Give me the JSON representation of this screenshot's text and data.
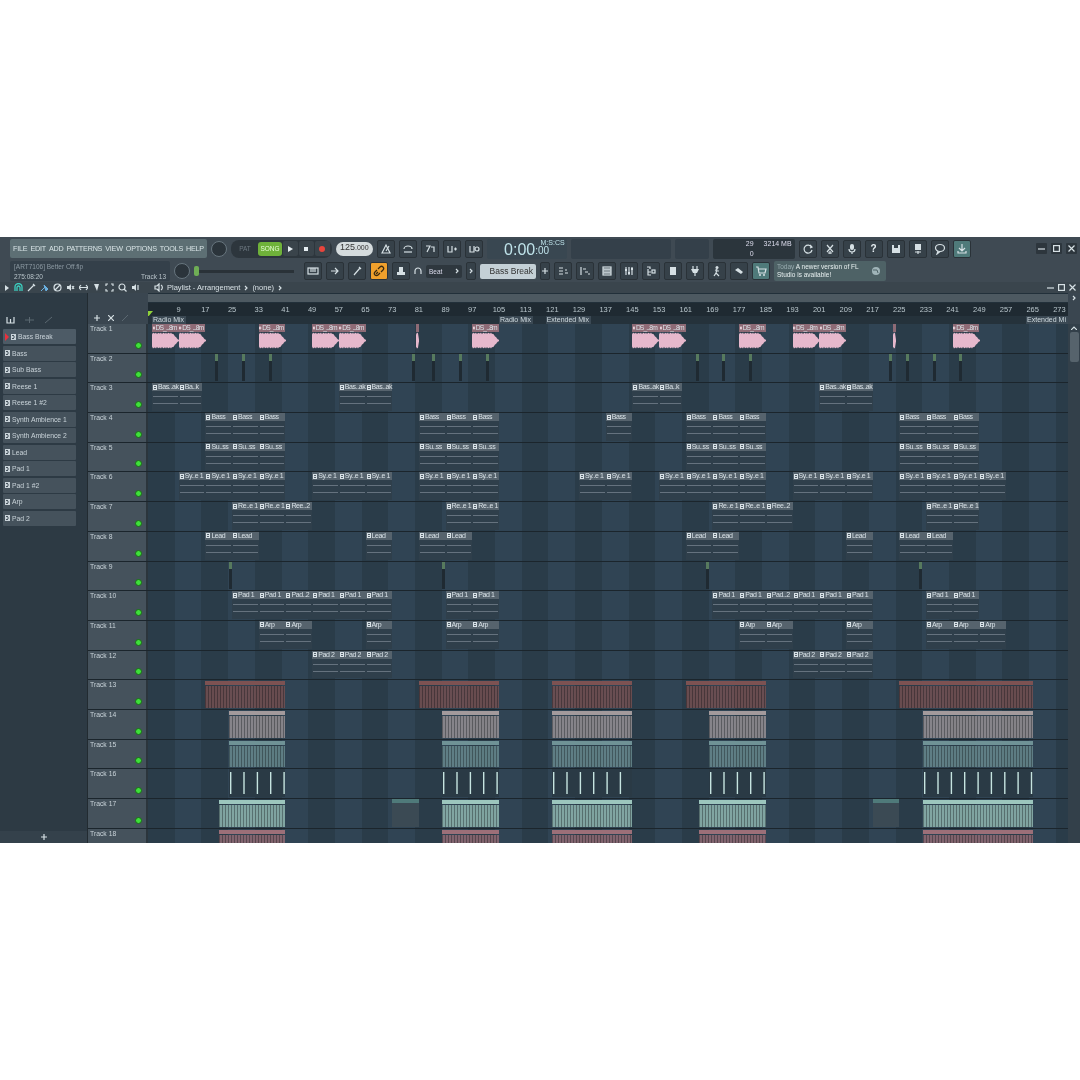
{
  "menu": [
    "FILE",
    "EDIT",
    "ADD",
    "PATTERNS",
    "VIEW",
    "OPTIONS",
    "TOOLS",
    "HELP"
  ],
  "hint": {
    "file": "[ART7106] Better Off.flp",
    "position": "275:08:20",
    "target": "Track 13"
  },
  "mode": [
    {
      "label": "PAT",
      "selected": false
    },
    {
      "label": "SONG",
      "selected": true
    }
  ],
  "tempo": {
    "main": "125",
    "fraction": ".000"
  },
  "time": {
    "main": "0:00",
    "sub": ":00",
    "unit": "M:S:CS"
  },
  "cpu": {
    "cpu": "29",
    "memory": "3214 MB",
    "polyphony": "0"
  },
  "help_glyph": "?",
  "pitch": {
    "level": 0
  },
  "snap_link": {
    "on": true
  },
  "snap": "Beat",
  "pattern": "Bass Break",
  "news": {
    "when": "Today",
    "text": "A newer version of FL Studio is available!"
  },
  "playlist": {
    "title": "Playlist - Arrangement",
    "target": "(none)"
  },
  "channels": [
    {
      "name": "Bass Break",
      "selected": true
    },
    {
      "name": "Bass",
      "selected": false
    },
    {
      "name": "Sub Bass",
      "selected": false
    },
    {
      "name": "Reese 1",
      "selected": false
    },
    {
      "name": "Reese 1 #2",
      "selected": false
    },
    {
      "name": "Synth Ambience 1",
      "selected": false
    },
    {
      "name": "Synth Ambience 2",
      "selected": false
    },
    {
      "name": "Lead",
      "selected": false
    },
    {
      "name": "Pad 1",
      "selected": false
    },
    {
      "name": "Pad 1 #2",
      "selected": false
    },
    {
      "name": "Arp",
      "selected": false
    },
    {
      "name": "Pad 2",
      "selected": false
    }
  ],
  "ruler": [
    "9",
    "17",
    "25",
    "33",
    "41",
    "49",
    "57",
    "65",
    "73",
    "81",
    "89",
    "97",
    "105",
    "113",
    "121",
    "129",
    "137",
    "145",
    "153",
    "161",
    "169",
    "177",
    "185",
    "193",
    "201",
    "209",
    "217",
    "225",
    "233",
    "241",
    "249",
    "257",
    "265",
    "273"
  ],
  "markers": [
    {
      "label": "Radio Mix"
    },
    {
      "label": "Radio Mix"
    },
    {
      "label": "Extended Mix"
    },
    {
      "label": "Extended Mi"
    }
  ],
  "tracks": [
    {
      "name": "Track 1",
      "enabled": true,
      "clips": [
        {
          "kind": "audio",
          "label": "DS_...8m"
        },
        {
          "kind": "audio",
          "label": "DS_...8m"
        },
        {
          "kind": "audio",
          "label": "DS_...8m"
        },
        {
          "kind": "audio",
          "label": "DS_...8m"
        },
        {
          "kind": "audio",
          "label": "DS_...8m"
        },
        {
          "kind": "audio"
        },
        {
          "kind": "audio",
          "label": "DS_...8m"
        },
        {
          "kind": "audio",
          "label": "DS_...8m"
        },
        {
          "kind": "audio",
          "label": "DS_...8m"
        },
        {
          "kind": "audio",
          "label": "DS_...8m"
        },
        {
          "kind": "audio",
          "label": "DS_...8m"
        },
        {
          "kind": "audio",
          "label": "DS_...8m"
        },
        {
          "kind": "audio"
        },
        {
          "kind": "audio",
          "label": "DS_...8m"
        }
      ]
    },
    {
      "name": "Track 2",
      "enabled": true,
      "clips": [
        {
          "kind": "tick"
        },
        {
          "kind": "tick"
        },
        {
          "kind": "tick"
        },
        {
          "kind": "tick"
        },
        {
          "kind": "tick"
        },
        {
          "kind": "tick"
        },
        {
          "kind": "tick"
        },
        {
          "kind": "tick"
        },
        {
          "kind": "tick"
        },
        {
          "kind": "tick"
        },
        {
          "kind": "tick"
        },
        {
          "kind": "tick"
        },
        {
          "kind": "tick"
        },
        {
          "kind": "tick"
        }
      ]
    },
    {
      "name": "Track 3",
      "enabled": true,
      "clips": [
        {
          "kind": "pattern",
          "label": "Bas..ak"
        },
        {
          "kind": "pattern",
          "label": "Ba..k"
        },
        {
          "kind": "pattern",
          "label": "Bas..ak"
        },
        {
          "kind": "pattern",
          "label": "Bas..ak"
        },
        {
          "kind": "pattern",
          "label": "Bas..ak"
        },
        {
          "kind": "pattern",
          "label": "Ba..k"
        },
        {
          "kind": "pattern",
          "label": "Bas..ak"
        },
        {
          "kind": "pattern",
          "label": "Bas..ak"
        }
      ]
    },
    {
      "name": "Track 4",
      "enabled": true,
      "clips": [
        {
          "kind": "pattern",
          "label": "Bass"
        },
        {
          "kind": "pattern",
          "label": "Bass"
        },
        {
          "kind": "pattern",
          "label": "Bass"
        },
        {
          "kind": "pattern",
          "label": "Bass"
        },
        {
          "kind": "pattern",
          "label": "Bass"
        },
        {
          "kind": "pattern",
          "label": "Bass"
        },
        {
          "kind": "pattern",
          "label": "Bass"
        },
        {
          "kind": "pattern",
          "label": "Bass"
        },
        {
          "kind": "pattern",
          "label": "Bass"
        },
        {
          "kind": "pattern",
          "label": "Bass"
        },
        {
          "kind": "pattern",
          "label": "Bass"
        },
        {
          "kind": "pattern",
          "label": "Bass"
        },
        {
          "kind": "pattern",
          "label": "Bass"
        }
      ]
    },
    {
      "name": "Track 5",
      "enabled": true,
      "clips": [
        {
          "kind": "pattern",
          "label": "Su..ss"
        },
        {
          "kind": "pattern",
          "label": "Su..ss"
        },
        {
          "kind": "pattern",
          "label": "Su..ss"
        },
        {
          "kind": "pattern",
          "label": "Su..ss"
        },
        {
          "kind": "pattern",
          "label": "Su..ss"
        },
        {
          "kind": "pattern",
          "label": "Su..ss"
        },
        {
          "kind": "pattern",
          "label": "Su..ss"
        },
        {
          "kind": "pattern",
          "label": "Su..ss"
        },
        {
          "kind": "pattern",
          "label": "Su..ss"
        },
        {
          "kind": "pattern",
          "label": "Su..ss"
        },
        {
          "kind": "pattern",
          "label": "Su..ss"
        },
        {
          "kind": "pattern",
          "label": "Su..ss"
        }
      ]
    },
    {
      "name": "Track 6",
      "enabled": true,
      "clips": [
        {
          "kind": "pattern",
          "label": "Sy..e 1"
        },
        {
          "kind": "pattern",
          "label": "Sy..e 1"
        },
        {
          "kind": "pattern",
          "label": "Sy..e 1"
        },
        {
          "kind": "pattern",
          "label": "Sy..e 1"
        },
        {
          "kind": "pattern",
          "label": "Sy..e 1"
        },
        {
          "kind": "pattern",
          "label": "Sy..e 1"
        },
        {
          "kind": "pattern",
          "label": "Sy..e 1"
        },
        {
          "kind": "pattern",
          "label": "Sy..e 1"
        },
        {
          "kind": "pattern",
          "label": "Sy..e 1"
        },
        {
          "kind": "pattern",
          "label": "Sy..e 1"
        },
        {
          "kind": "pattern",
          "label": "Sy..e 1"
        },
        {
          "kind": "pattern",
          "label": "Sy..e 1"
        },
        {
          "kind": "pattern",
          "label": "Sy..e 1"
        },
        {
          "kind": "pattern",
          "label": "Sy..e 1"
        },
        {
          "kind": "pattern",
          "label": "Sy..e 1"
        },
        {
          "kind": "pattern",
          "label": "Sy..e 1"
        },
        {
          "kind": "pattern",
          "label": "Sy..e 1"
        },
        {
          "kind": "pattern",
          "label": "Sy..e 1"
        },
        {
          "kind": "pattern",
          "label": "Sy..e 1"
        },
        {
          "kind": "pattern",
          "label": "Sy..e 1"
        },
        {
          "kind": "pattern",
          "label": "Sy..e 1"
        },
        {
          "kind": "pattern",
          "label": "Sy..e 1"
        },
        {
          "kind": "pattern",
          "label": "Sy..e 1"
        }
      ]
    },
    {
      "name": "Track 7",
      "enabled": true,
      "clips": [
        {
          "kind": "pattern",
          "label": "Re..e 1"
        },
        {
          "kind": "pattern",
          "label": "Re..e 1"
        },
        {
          "kind": "pattern",
          "label": "Ree..2"
        },
        {
          "kind": "pattern",
          "label": "Re..e 1"
        },
        {
          "kind": "pattern",
          "label": "Re..e 1"
        },
        {
          "kind": "pattern",
          "label": "Re..e 1"
        },
        {
          "kind": "pattern",
          "label": "Re..e 1"
        },
        {
          "kind": "pattern",
          "label": "Ree..2"
        },
        {
          "kind": "pattern",
          "label": "Re..e 1"
        },
        {
          "kind": "pattern",
          "label": "Re..e 1"
        }
      ]
    },
    {
      "name": "Track 8",
      "enabled": true,
      "clips": [
        {
          "kind": "pattern",
          "label": "Lead"
        },
        {
          "kind": "pattern",
          "label": "Lead"
        },
        {
          "kind": "pattern",
          "label": "Lead"
        },
        {
          "kind": "pattern",
          "label": "Lead"
        },
        {
          "kind": "pattern",
          "label": "Lead"
        },
        {
          "kind": "pattern",
          "label": "Lead"
        },
        {
          "kind": "pattern",
          "label": "Lead"
        },
        {
          "kind": "pattern",
          "label": "Lead"
        },
        {
          "kind": "pattern",
          "label": "Lead"
        },
        {
          "kind": "pattern",
          "label": "Lead"
        }
      ]
    },
    {
      "name": "Track 9",
      "enabled": true,
      "clips": [
        {
          "kind": "tick"
        },
        {
          "kind": "tick"
        },
        {
          "kind": "tick"
        },
        {
          "kind": "tick"
        }
      ]
    },
    {
      "name": "Track 10",
      "enabled": true,
      "clips": [
        {
          "kind": "pattern",
          "label": "Pad 1"
        },
        {
          "kind": "pattern",
          "label": "Pad 1"
        },
        {
          "kind": "pattern",
          "label": "Pad..2"
        },
        {
          "kind": "pattern",
          "label": "Pad 1"
        },
        {
          "kind": "pattern",
          "label": "Pad 1"
        },
        {
          "kind": "pattern",
          "label": "Pad 1"
        },
        {
          "kind": "pattern",
          "label": "Pad 1"
        },
        {
          "kind": "pattern",
          "label": "Pad 1"
        },
        {
          "kind": "pattern",
          "label": "Pad 1"
        },
        {
          "kind": "pattern",
          "label": "Pad 1"
        },
        {
          "kind": "pattern",
          "label": "Pad..2"
        },
        {
          "kind": "pattern",
          "label": "Pad 1"
        },
        {
          "kind": "pattern",
          "label": "Pad 1"
        },
        {
          "kind": "pattern",
          "label": "Pad 1"
        },
        {
          "kind": "pattern",
          "label": "Pad 1"
        },
        {
          "kind": "pattern",
          "label": "Pad 1"
        }
      ]
    },
    {
      "name": "Track 11",
      "enabled": true,
      "clips": [
        {
          "kind": "pattern",
          "label": "Arp"
        },
        {
          "kind": "pattern",
          "label": "Arp"
        },
        {
          "kind": "pattern",
          "label": "Arp"
        },
        {
          "kind": "pattern",
          "label": "Arp"
        },
        {
          "kind": "pattern",
          "label": "Arp"
        },
        {
          "kind": "pattern",
          "label": "Arp"
        },
        {
          "kind": "pattern",
          "label": "Arp"
        },
        {
          "kind": "pattern",
          "label": "Arp"
        },
        {
          "kind": "pattern",
          "label": "Arp"
        },
        {
          "kind": "pattern",
          "label": "Arp"
        },
        {
          "kind": "pattern",
          "label": "Arp"
        }
      ]
    },
    {
      "name": "Track 12",
      "enabled": true,
      "clips": [
        {
          "kind": "pattern",
          "label": "Pad 2"
        },
        {
          "kind": "pattern",
          "label": "Pad 2"
        },
        {
          "kind": "pattern",
          "label": "Pad 2"
        },
        {
          "kind": "pattern",
          "label": "Pad 2"
        },
        {
          "kind": "pattern",
          "label": "Pad 2"
        },
        {
          "kind": "pattern",
          "label": "Pad 2"
        }
      ]
    },
    {
      "name": "Track 13",
      "enabled": true,
      "clips": [
        {
          "kind": "loop",
          "color": "#7d5252"
        },
        {
          "kind": "loop",
          "color": "#7d5252"
        },
        {
          "kind": "loop",
          "color": "#7d5252"
        },
        {
          "kind": "loop",
          "color": "#7d5252"
        },
        {
          "kind": "loop",
          "color": "#7d5252"
        }
      ]
    },
    {
      "name": "Track 14",
      "enabled": true,
      "clips": [
        {
          "kind": "loop",
          "color": "#a39a9c"
        },
        {
          "kind": "loop",
          "color": "#a39a9c"
        },
        {
          "kind": "loop",
          "color": "#a39a9c"
        },
        {
          "kind": "loop",
          "color": "#a39a9c"
        },
        {
          "kind": "loop",
          "color": "#a39a9c"
        }
      ]
    },
    {
      "name": "Track 15",
      "enabled": true,
      "clips": [
        {
          "kind": "loop",
          "color": "#6f9296"
        },
        {
          "kind": "loop",
          "color": "#6f9296"
        },
        {
          "kind": "loop",
          "color": "#6f9296"
        },
        {
          "kind": "loop",
          "color": "#6f9296"
        },
        {
          "kind": "loop",
          "color": "#6f9296"
        }
      ]
    },
    {
      "name": "Track 16",
      "enabled": true,
      "clips": [
        {
          "kind": "hits"
        },
        {
          "kind": "hits"
        },
        {
          "kind": "hits"
        },
        {
          "kind": "hits"
        },
        {
          "kind": "hits"
        }
      ]
    },
    {
      "name": "Track 17",
      "enabled": true,
      "clips": [
        {
          "kind": "loop",
          "color": "#9cc6bd"
        },
        {
          "kind": "block"
        },
        {
          "kind": "loop",
          "color": "#9cc6bd"
        },
        {
          "kind": "loop",
          "color": "#9cc6bd"
        },
        {
          "kind": "loop",
          "color": "#9cc6bd"
        },
        {
          "kind": "block"
        },
        {
          "kind": "loop",
          "color": "#9cc6bd"
        }
      ]
    },
    {
      "name": "Track 18",
      "clips": [
        {
          "kind": "loop",
          "color": "#9c6f78"
        },
        {
          "kind": "loop",
          "color": "#9c6f78"
        },
        {
          "kind": "loop",
          "color": "#9c6f78"
        },
        {
          "kind": "loop",
          "color": "#9c6f78"
        },
        {
          "kind": "loop",
          "color": "#9c6f78"
        }
      ]
    }
  ]
}
